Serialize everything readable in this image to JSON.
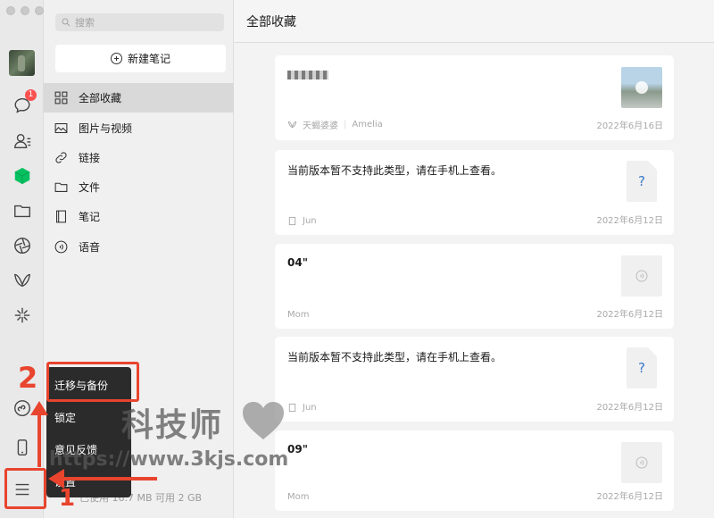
{
  "search": {
    "placeholder": "搜索"
  },
  "rail": {
    "badge": "1"
  },
  "sidebar": {
    "new_note": "新建笔记",
    "categories": [
      {
        "label": "全部收藏",
        "icon": "grid-icon"
      },
      {
        "label": "图片与视频",
        "icon": "image-icon"
      },
      {
        "label": "链接",
        "icon": "link-icon"
      },
      {
        "label": "文件",
        "icon": "folder-icon"
      },
      {
        "label": "笔记",
        "icon": "notebook-icon"
      },
      {
        "label": "语音",
        "icon": "voice-icon"
      }
    ],
    "storage": "已使用 16.7 MB 可用 2 GB"
  },
  "menu": {
    "items": [
      "迁移与备份",
      "锁定",
      "意见反馈",
      "设置"
    ]
  },
  "annotations": {
    "step1": "1",
    "step2": "2"
  },
  "main": {
    "title": "全部收藏",
    "cards": [
      {
        "title": "",
        "source": "天蝎婆婆",
        "author": "Amelia",
        "date": "2022年6月16日",
        "thumb": "video"
      },
      {
        "title": "当前版本暂不支持此类型，请在手机上查看。",
        "source": "Jun",
        "date": "2022年6月12日",
        "thumb": "file"
      },
      {
        "title": "04\"",
        "source": "Mom",
        "date": "2022年6月12日",
        "thumb": "voice"
      },
      {
        "title": "当前版本暂不支持此类型，请在手机上查看。",
        "source": "Jun",
        "date": "2022年6月12日",
        "thumb": "file"
      },
      {
        "title": "09\"",
        "source": "Mom",
        "date": "2022年6月12日",
        "thumb": "voice"
      }
    ]
  },
  "watermark": {
    "text": "科技师",
    "url": "https://www.3kjs.com"
  },
  "colors": {
    "accent": "#07c160",
    "annotation": "#e8442e",
    "badge": "#fa5151"
  }
}
